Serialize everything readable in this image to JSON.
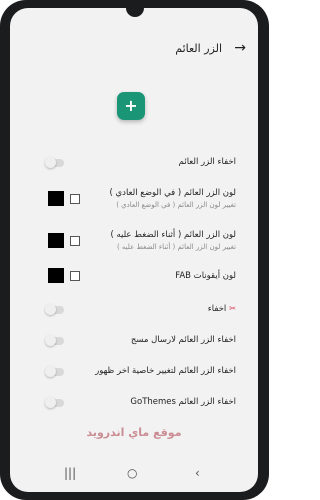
{
  "appbar": {
    "title": "الزر العائم",
    "back_icon": "arrow-right-icon"
  },
  "fab": {
    "label": "+",
    "color": "#1a9677"
  },
  "rows": [
    {
      "title": "اخفاء الزر العائم"
    },
    {
      "title": "لون الزر العائم ( في الوضع العادي )",
      "subtitle": "تغيير لون الزر العائم ( في الوضع العادي )"
    },
    {
      "title": "لون الزر العائم ( أثناء الضغط عليه )",
      "subtitle": "تغيير لون الزر العائم ( أثناء الضغط عليه )"
    },
    {
      "title": "لون أيقونات FAB"
    },
    {
      "title": "اخفاء"
    },
    {
      "title": "اخفاء الزر العائم لارسال مسج"
    },
    {
      "title": "اخفاء الزر العائم لتغيير خاصية اخر ظهور"
    },
    {
      "title": "اخفاء الزر العائم GoThemes"
    }
  ],
  "watermark": "موقع ماي اندرويد",
  "navbar": {
    "recents": "|||",
    "home": "○",
    "back": "‹"
  }
}
